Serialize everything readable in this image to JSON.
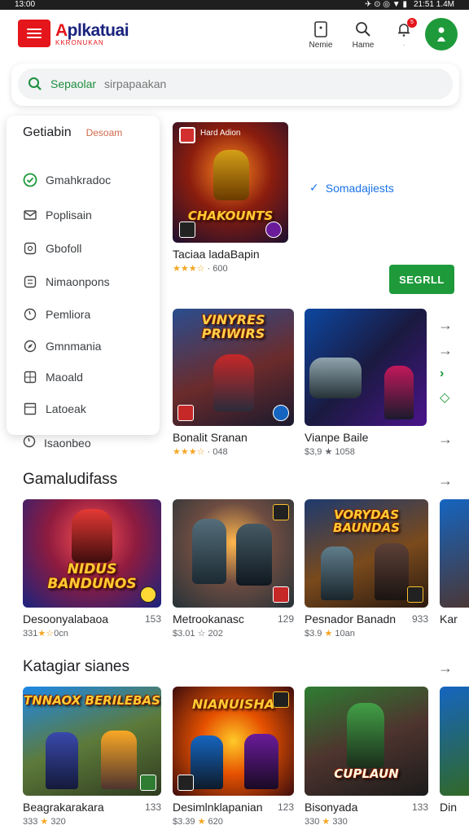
{
  "statusbar": {
    "left": "13:00",
    "right": "21:51 1.4M"
  },
  "header": {
    "logo_main_a": "A",
    "logo_main_rest": "plkatuai",
    "logo_sub": "KKRONUKAN",
    "icon1_label": "Nemie",
    "icon2_label": "Hame",
    "notif_count": "5"
  },
  "search": {
    "label": "Sepaolar",
    "placeholder": "sirpapaakan"
  },
  "panel": {
    "title": "Getiabin",
    "tag": "Desoam",
    "items": [
      "Gmahkradoc",
      "Poplisain",
      "Gbofoll",
      "Nimaonpons",
      "Pemliora",
      "Gmnmania",
      "Maoald",
      "Latoeak"
    ],
    "outside_item": "Isaonbeo"
  },
  "featured": {
    "thumb_text": "CHAKOUNTS",
    "thumb_tag": "Hard Adion",
    "name": "Taciaa ladaBapin",
    "stars": "★★★☆",
    "meta": "· 600",
    "verified": "Somadajiests",
    "button": "SEGRLL"
  },
  "row1": [
    {
      "name": "Bonalit Sranan",
      "stars": "★★★☆",
      "meta": "· 048",
      "thumb_text": "VINYRES PRIWIRS"
    },
    {
      "name": "Vianpe Baile",
      "stars": "",
      "meta": "$3,9 ★ 1058",
      "thumb_text": ""
    }
  ],
  "sections": [
    {
      "title": "Gamaludifass",
      "cards": [
        {
          "name": "Desoonyalabaoa",
          "num": "153",
          "meta_a": "331",
          "stars": "★☆",
          "meta_b": "0cn",
          "thumb_text": "NIDUS BANDUNOS"
        },
        {
          "name": "Metrookanasc",
          "num": "129",
          "meta_a": "$3.01 ☆ 202",
          "stars": "",
          "meta_b": "",
          "thumb_text": ""
        },
        {
          "name": "Pesnador Banadn",
          "num": "933",
          "meta_a": "$3.9",
          "stars": "★",
          "meta_b": "10an",
          "thumb_text": "VORYDAS BAUNDAS"
        },
        {
          "name": "Kar",
          "num": "",
          "meta_a": "",
          "stars": "",
          "meta_b": "",
          "thumb_text": ""
        }
      ]
    },
    {
      "title": "Katagiar sianes",
      "cards": [
        {
          "name": "Beagrakarakara",
          "num": "133",
          "meta_a": "333",
          "stars": "★",
          "meta_b": "320",
          "thumb_text": "TNNAOX BERILEBAS"
        },
        {
          "name": "Desimlnklapanian",
          "num": "123",
          "meta_a": "$3.39",
          "stars": "★",
          "meta_b": "620",
          "thumb_text": "NIANUISHA"
        },
        {
          "name": "Bisonyada",
          "num": "133",
          "meta_a": "330",
          "stars": "★",
          "meta_b": "330",
          "thumb_text": "CUPLAUN"
        },
        {
          "name": "Din",
          "num": "",
          "meta_a": "",
          "stars": "",
          "meta_b": "",
          "thumb_text": ""
        }
      ]
    }
  ],
  "colors": {
    "brand_red": "#e4161b",
    "brand_green": "#1e9a3a",
    "accent_blue": "#1a73e8",
    "star": "#f5a623"
  }
}
